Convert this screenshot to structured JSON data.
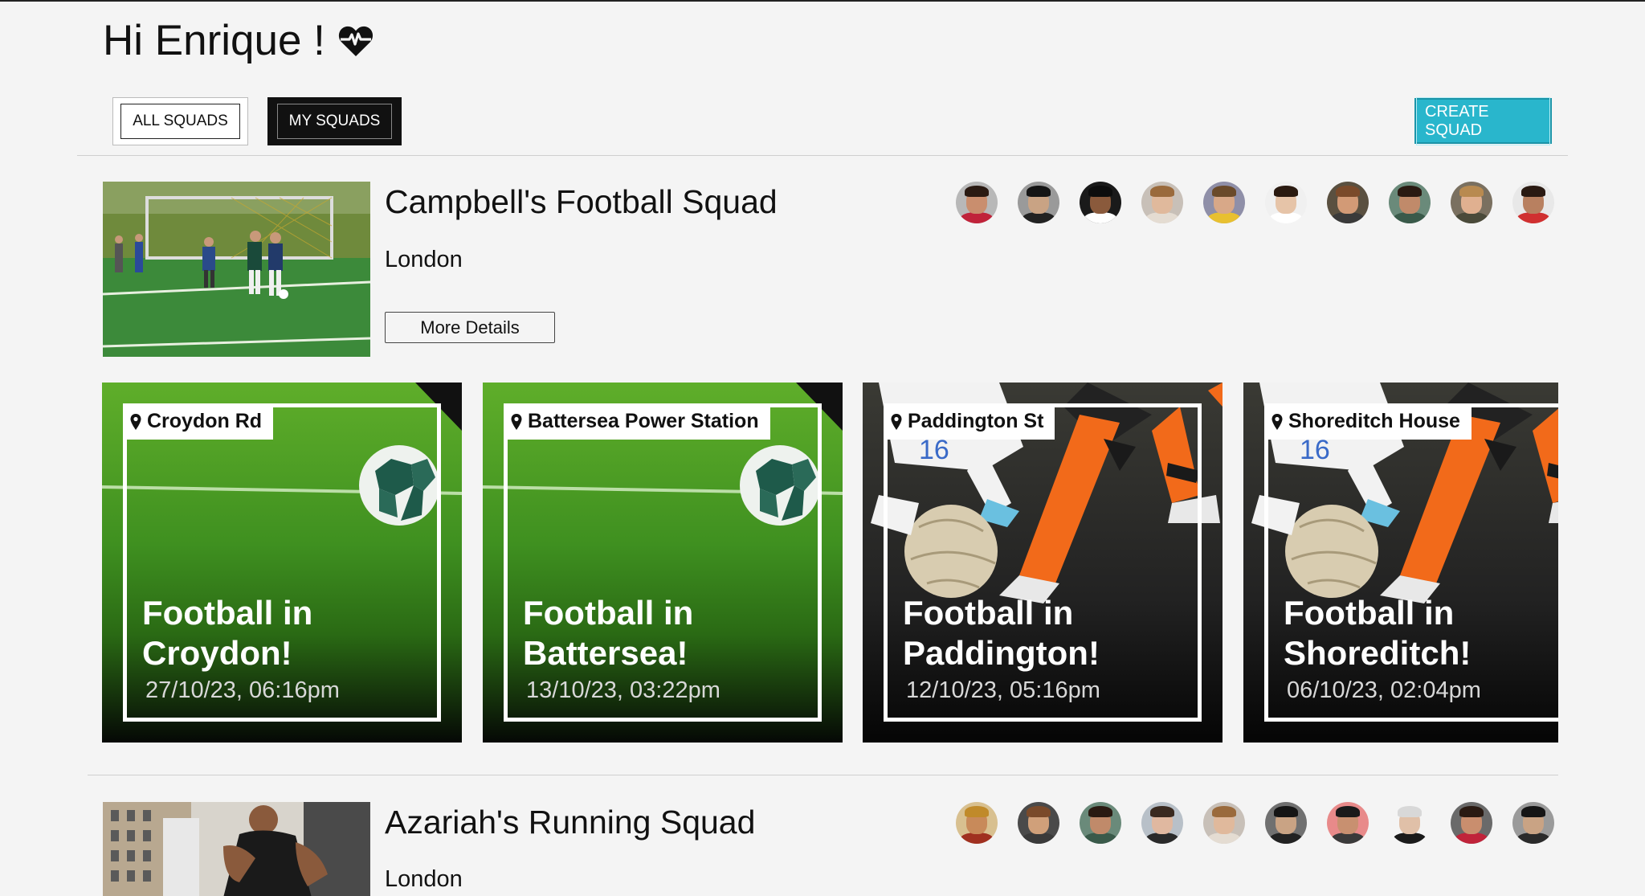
{
  "greeting": "Hi Enrique !",
  "tabs": {
    "all": "ALL SQUADS",
    "my": "MY SQUADS"
  },
  "create_button": "CREATE SQUAD",
  "squads": [
    {
      "title": "Campbell's Football Squad",
      "city": "London",
      "more_details": "More Details",
      "avatars": [
        {
          "skin": "#c98e6e",
          "hair": "#2a1a12",
          "shirt": "#c0233a",
          "bg": "#b8b8b8"
        },
        {
          "skin": "#c9a384",
          "hair": "#151515",
          "shirt": "#222",
          "bg": "#9a9a9a"
        },
        {
          "skin": "#8a5a3c",
          "hair": "#0d0d0d",
          "shirt": "#fff",
          "bg": "#1a1a1a"
        },
        {
          "skin": "#e0b99c",
          "hair": "#9a6a3c",
          "shirt": "#e4dcd2",
          "bg": "#c8c0b8"
        },
        {
          "skin": "#d8a888",
          "hair": "#6a4a2a",
          "shirt": "#e8c030",
          "bg": "#8f8fa8"
        },
        {
          "skin": "#e6c4a8",
          "hair": "#2a1a10",
          "shirt": "#fff",
          "bg": "#f0f0f0"
        },
        {
          "skin": "#d29a76",
          "hair": "#7a4a2a",
          "shirt": "#3a3a3a",
          "bg": "#5a5040"
        },
        {
          "skin": "#c08a6a",
          "hair": "#2a1a12",
          "shirt": "#3a5a4a",
          "bg": "#6a8a7a"
        },
        {
          "skin": "#e0b090",
          "hair": "#b88a50",
          "shirt": "#4a4a3a",
          "bg": "#7a7060"
        },
        {
          "skin": "#b88060",
          "hair": "#2a1a12",
          "shirt": "#d03030",
          "bg": "#e8e8e8"
        }
      ]
    },
    {
      "title": "Azariah's Running Squad",
      "city": "London",
      "avatars": [
        {
          "skin": "#c88a5a",
          "hair": "#c08a2a",
          "shirt": "#a03020",
          "bg": "#d8c090"
        },
        {
          "skin": "#d0a07a",
          "hair": "#7a4a2a",
          "shirt": "#3a3a3a",
          "bg": "#4a4a4a"
        },
        {
          "skin": "#c08a6a",
          "hair": "#2a1a12",
          "shirt": "#3a5a4a",
          "bg": "#6a8a7a"
        },
        {
          "skin": "#e0b8a0",
          "hair": "#3a2a20",
          "shirt": "#2a2a2a",
          "bg": "#b8c0c8"
        },
        {
          "skin": "#e0b99c",
          "hair": "#9a6a3c",
          "shirt": "#e4dcd2",
          "bg": "#c8c0b8"
        },
        {
          "skin": "#c9a384",
          "hair": "#151515",
          "shirt": "#222",
          "bg": "#707070"
        },
        {
          "skin": "#c89070",
          "hair": "#1a1a1a",
          "shirt": "#3a3a3a",
          "bg": "#e88a8a"
        },
        {
          "skin": "#e0c0a8",
          "hair": "#d8d8d8",
          "shirt": "#1a1a1a",
          "bg": "#f4f4f4"
        },
        {
          "skin": "#c98e6e",
          "hair": "#2a1a12",
          "shirt": "#c0233a",
          "bg": "#6a6a6a"
        },
        {
          "skin": "#c9a384",
          "hair": "#151515",
          "shirt": "#2a2a2a",
          "bg": "#9a9a9a"
        }
      ]
    }
  ],
  "events": [
    {
      "location": "Croydon Rd",
      "title": "Football in Croydon!",
      "date": "27/10/23, 06:16pm",
      "theme": "grass"
    },
    {
      "location": "Battersea Power Station",
      "title": "Football in Battersea!",
      "date": "13/10/23, 03:22pm",
      "theme": "grass"
    },
    {
      "location": "Paddington St",
      "title": "Football in Paddington!",
      "date": "12/10/23, 05:16pm",
      "theme": "dark"
    },
    {
      "location": "Shoreditch House",
      "title": "Football in Shoreditch!",
      "date": "06/10/23, 02:04pm",
      "theme": "dark"
    }
  ]
}
